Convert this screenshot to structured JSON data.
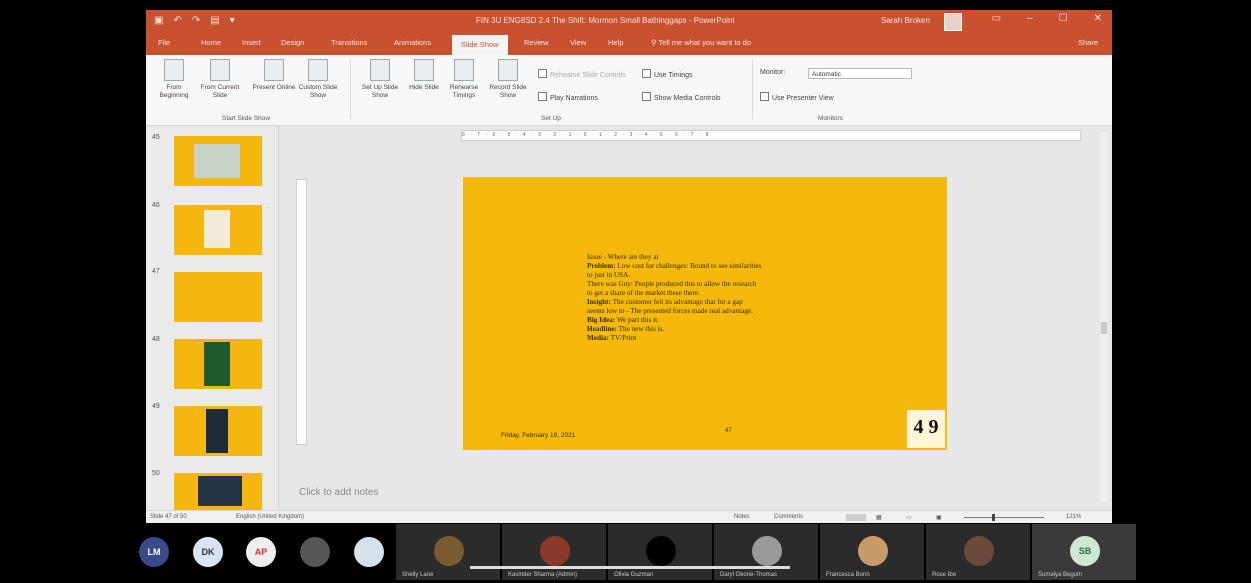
{
  "window": {
    "title": "FIN 3U ENG8SD 2.4 The Shift: Mormon Small Bathinggaps - PowerPoint",
    "user": "Sarah Broken",
    "controls": [
      "▭",
      "–",
      "☐",
      "✕"
    ]
  },
  "ribbon_tabs": [
    {
      "label": "File"
    },
    {
      "label": "Home"
    },
    {
      "label": "Insert"
    },
    {
      "label": "Design"
    },
    {
      "label": "Transitions"
    },
    {
      "label": "Animations"
    },
    {
      "label": "Slide Show",
      "active": true
    },
    {
      "label": "Review"
    },
    {
      "label": "View"
    },
    {
      "label": "Help"
    }
  ],
  "tell_me": "Tell me what you want to do",
  "share": "Share",
  "ribbon": {
    "start_group": {
      "buttons": [
        "From Beginning",
        "From Current Slide",
        "Present Online",
        "Custom Slide Show"
      ],
      "label": "Start Slide Show"
    },
    "setup_group": {
      "buttons": [
        "Set Up Slide Show",
        "Hide Slide",
        "Rehearse Timings",
        "Record Slide Show"
      ],
      "checks": [
        {
          "label": "Play Narrations",
          "checked": true
        },
        {
          "label": "Use Timings",
          "checked": true
        },
        {
          "label": "Show Media Controls",
          "checked": true
        }
      ],
      "disabled_check": "Rehearse Slide Controls",
      "label": "Set Up"
    },
    "monitors_group": {
      "monitor_label": "Monitor:",
      "monitor_value": "Automatic",
      "presenter_view": "Use Presenter View",
      "label": "Monitors"
    }
  },
  "slides": [
    {
      "num": "45"
    },
    {
      "num": "46"
    },
    {
      "num": "47"
    },
    {
      "num": "48"
    },
    {
      "num": "49"
    },
    {
      "num": "50"
    }
  ],
  "slide": {
    "lines": [
      {
        "bold": "",
        "text": "Issue - Where are they at"
      },
      {
        "bold": "Problem:",
        "text": " Low cost for challenges: Bound to see similarities"
      },
      {
        "bold": "",
        "text": "to just in USA."
      },
      {
        "bold": "",
        "text": "There was Guy: People produced this to allow the research"
      },
      {
        "bold": "",
        "text": "to get a share of the market these there."
      },
      {
        "bold": "Insight:",
        "text": " The customer felt its advantage that for a gap"
      },
      {
        "bold": "",
        "text": "seems low to - The presented forces made real advantage."
      },
      {
        "bold": "Big Idea:",
        "text": " We part this it."
      },
      {
        "bold": "Headline:",
        "text": " The new this is."
      },
      {
        "bold": "Media:",
        "text": " TV/Print"
      }
    ],
    "date": "Friday, February 19, 2021",
    "page": "47",
    "logo": "4 9"
  },
  "notes_placeholder": "Click to add notes",
  "status": {
    "slide": "Slide 47 of 50",
    "lang": "English (United Kingdom)",
    "notes": "Notes",
    "comments": "Comments",
    "zoom": "121%"
  },
  "participants": [
    {
      "initials": "LM",
      "color": "#3a4a8a"
    },
    {
      "initials": "DK",
      "color": "#d9e4f2"
    },
    {
      "initials": "AP",
      "color": "#e6e6e6"
    },
    {
      "initials": "",
      "color": "#555"
    },
    {
      "initials": "",
      "color": "#d6e2ec"
    }
  ],
  "tiles": [
    {
      "name": "Shelly Lane"
    },
    {
      "name": "Kavinder Sharma (Admin)"
    },
    {
      "name": "Olivia Guzman"
    },
    {
      "name": "Daryl Okorie-Thomas"
    },
    {
      "name": "Francesca Bonn"
    },
    {
      "name": "Rose Ibo"
    },
    {
      "name": "Sumaiya Begum",
      "initials": "SB"
    }
  ]
}
